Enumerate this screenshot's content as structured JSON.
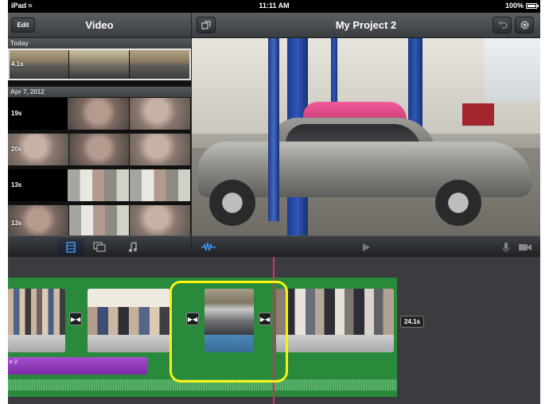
{
  "status_bar": {
    "device": "iPad",
    "time": "11:11 AM",
    "battery": "100%"
  },
  "browser_header": {
    "edit_label": "Edit",
    "title": "Video"
  },
  "project_header": {
    "title": "My Project 2"
  },
  "clip_browser": {
    "sections": [
      {
        "label": "Today",
        "clips": [
          {
            "duration": "4.1s"
          }
        ]
      },
      {
        "label": "Apr 7, 2012",
        "clips": [
          {
            "duration": "19s"
          },
          {
            "duration": "20s"
          },
          {
            "duration": "13s"
          },
          {
            "duration": "13s"
          }
        ]
      }
    ]
  },
  "timeline": {
    "audio_clip_label": "e 2",
    "project_duration": "24.1s",
    "highlight_color": "#f7f315",
    "playhead_color": "#e6256f",
    "track_color": "#288a3a"
  },
  "icons": {
    "media_tabs": [
      "film-strip-icon",
      "photos-icon",
      "music-note-icon"
    ],
    "viewer_controls": [
      "audio-waveform-icon",
      "play-icon",
      "microphone-icon",
      "camera-icon"
    ],
    "header_buttons": [
      "projects-icon",
      "undo-icon",
      "settings-gear-icon"
    ]
  }
}
